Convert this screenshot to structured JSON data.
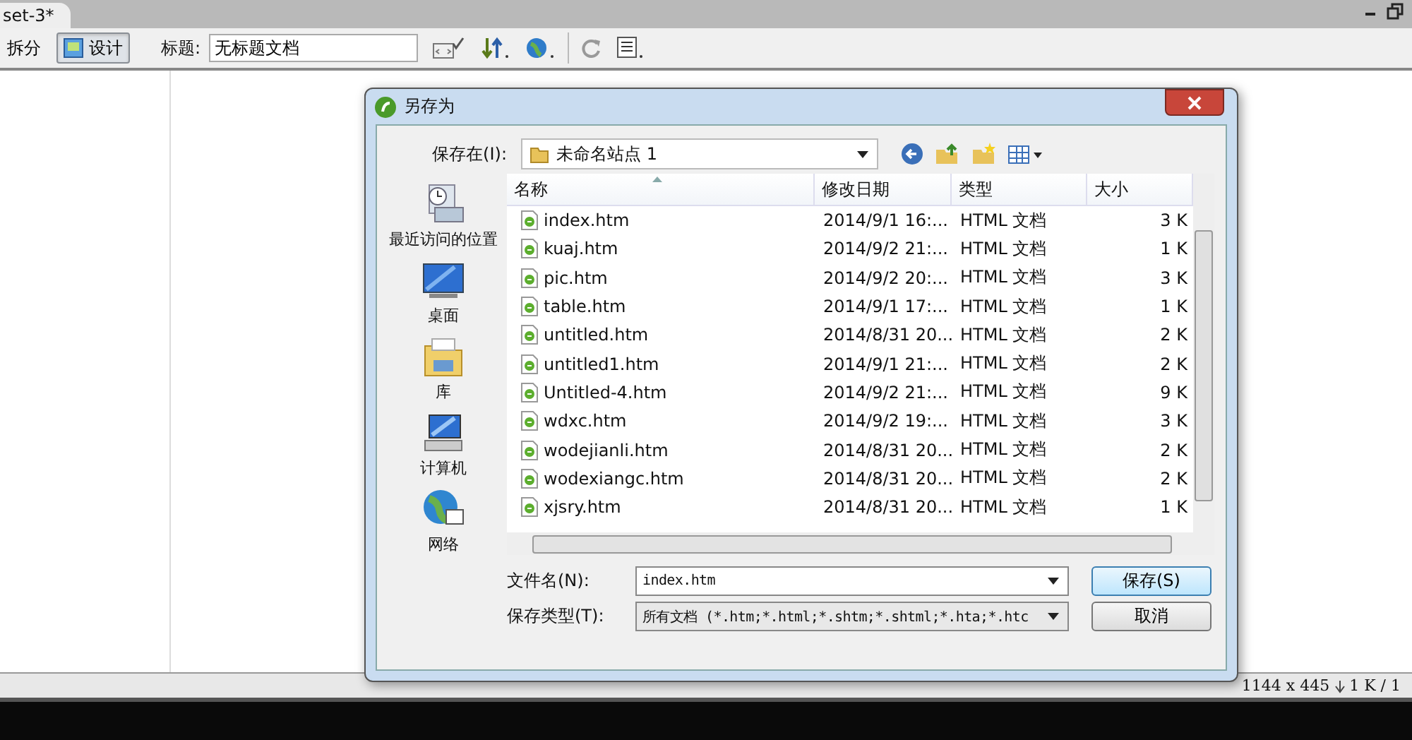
{
  "editor": {
    "tab": "set-3*",
    "view_buttons": [
      {
        "label": "拆分",
        "selected": false
      },
      {
        "label": "设计",
        "selected": true
      }
    ],
    "title_label": "标题:",
    "title_value": "无标题文档"
  },
  "dialog": {
    "title": "另存为",
    "save_in_label": "保存在(I):",
    "save_in_value": "未命名站点 1",
    "places": [
      {
        "label": "最近访问的位置",
        "kind": "recent"
      },
      {
        "label": "桌面",
        "kind": "desktop"
      },
      {
        "label": "库",
        "kind": "library"
      },
      {
        "label": "计算机",
        "kind": "computer"
      },
      {
        "label": "网络",
        "kind": "network"
      }
    ],
    "columns": [
      "名称",
      "修改日期",
      "类型",
      "大小"
    ],
    "rows": [
      {
        "name": "index.htm",
        "date": "2014/9/1 16:...",
        "type": "HTML 文档",
        "size": "3 K"
      },
      {
        "name": "kuaj.htm",
        "date": "2014/9/2 21:...",
        "type": "HTML 文档",
        "size": "1 K"
      },
      {
        "name": "pic.htm",
        "date": "2014/9/2 20:...",
        "type": "HTML 文档",
        "size": "3 K"
      },
      {
        "name": "table.htm",
        "date": "2014/9/1 17:...",
        "type": "HTML 文档",
        "size": "1 K"
      },
      {
        "name": "untitled.htm",
        "date": "2014/8/31 20...",
        "type": "HTML 文档",
        "size": "2 K"
      },
      {
        "name": "untitled1.htm",
        "date": "2014/9/1 21:...",
        "type": "HTML 文档",
        "size": "2 K"
      },
      {
        "name": "Untitled-4.htm",
        "date": "2014/9/2 21:...",
        "type": "HTML 文档",
        "size": "9 K"
      },
      {
        "name": "wdxc.htm",
        "date": "2014/9/2 19:...",
        "type": "HTML 文档",
        "size": "3 K"
      },
      {
        "name": "wodejianli.htm",
        "date": "2014/8/31 20...",
        "type": "HTML 文档",
        "size": "2 K"
      },
      {
        "name": "wodexiangc.htm",
        "date": "2014/8/31 20...",
        "type": "HTML 文档",
        "size": "2 K"
      },
      {
        "name": "xjsry.htm",
        "date": "2014/8/31 20...",
        "type": "HTML 文档",
        "size": "1 K"
      }
    ],
    "filename_label": "文件名(N):",
    "filename_value": "index.htm",
    "filetype_label": "保存类型(T):",
    "filetype_value": "所有文档 (*.htm;*.html;*.shtm;*.shtml;*.hta;*.htc",
    "buttons": [
      {
        "label": "保存(S)",
        "kind": "primary"
      },
      {
        "label": "取消",
        "kind": "normal"
      }
    ]
  },
  "status_bar": {
    "dimensions": "1144 x 445",
    "size": "1 K / 1"
  }
}
